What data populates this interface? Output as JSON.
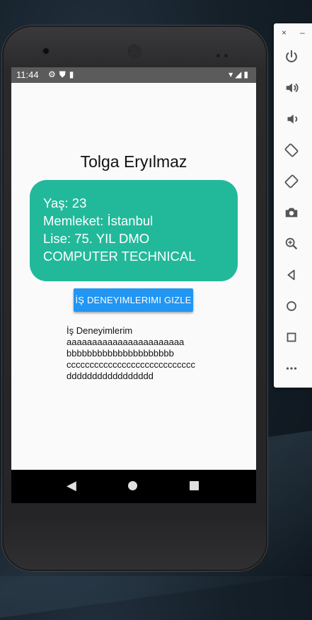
{
  "status_bar": {
    "time": "11:44",
    "left_icons": [
      "gear-icon",
      "shield-icon",
      "sd-card-icon"
    ],
    "right_icons": [
      "wifi-icon",
      "signal-icon",
      "battery-icon"
    ]
  },
  "app": {
    "name": "Tolga Eryılmaz",
    "card": {
      "age": "Yaş: 23",
      "hometown": "Memleket: İstanbul",
      "school_line1": "Lise: 75. YIL DMO",
      "school_line2": "COMPUTER TECHNICAL",
      "background_color": "#22b99b"
    },
    "toggle_button_label": "İŞ DENEYIMLERIMI GIZLE",
    "button_color": "#2196f3",
    "experience": {
      "heading": "İş Deneyimlerim",
      "items": [
        "aaaaaaaaaaaaaaaaaaaaaaa",
        "bbbbbbbbbbbbbbbbbbbbb",
        "cccccccccccccccccccccccccccc",
        "ddddddddddddddddd"
      ]
    }
  },
  "nav_bar": {
    "buttons": [
      "back-icon",
      "home-icon",
      "recents-icon"
    ]
  },
  "emulator_panel": {
    "window_controls": {
      "close": "×",
      "minimize": "–"
    },
    "tools": [
      "power-icon",
      "volume-up-icon",
      "volume-down-icon",
      "rotate-left-icon",
      "rotate-right-icon",
      "camera-icon",
      "zoom-icon",
      "back-icon",
      "home-icon",
      "overview-icon",
      "more-icon"
    ]
  }
}
